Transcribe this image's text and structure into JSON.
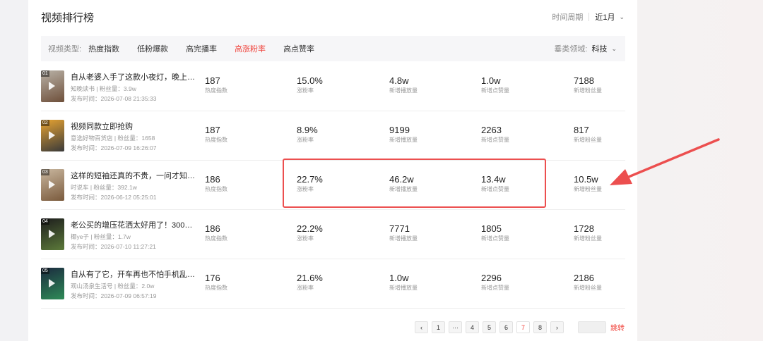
{
  "header": {
    "title": "视频排行榜",
    "period_label": "时间周期",
    "period_value": "近1月"
  },
  "filters": {
    "type_label": "视频类型:",
    "items": [
      "热度指数",
      "低粉爆款",
      "高完播率",
      "高涨粉率",
      "高点赞率"
    ],
    "active_index": 3,
    "domain_label": "垂类领域:",
    "domain_value": "科技"
  },
  "rows": [
    {
      "rank": "01",
      "title": "自从老婆入手了这款小夜灯，晚上再…",
      "meta": "知晚读书 | 粉丝量：3.9w",
      "time": "发布时间：2026-07-08 21:35:33",
      "metrics": [
        {
          "v": "187",
          "l": "热度指数"
        },
        {
          "v": "15.0%",
          "l": "涨粉率"
        },
        {
          "v": "4.8w",
          "l": "新增播放量"
        },
        {
          "v": "1.0w",
          "l": "新增点赞量"
        },
        {
          "v": "7188",
          "l": "新增粉丝量"
        }
      ],
      "thumb_colors": [
        "#b9b2a7",
        "#6e4f3a"
      ]
    },
    {
      "rank": "02",
      "title": "视频同款立即抢购",
      "meta": "意选好物百货店 | 粉丝量：1658",
      "time": "发布时间：2026-07-09 16:26:07",
      "metrics": [
        {
          "v": "187",
          "l": "热度指数"
        },
        {
          "v": "8.9%",
          "l": "涨粉率"
        },
        {
          "v": "9199",
          "l": "新增播放量"
        },
        {
          "v": "2263",
          "l": "新增点赞量"
        },
        {
          "v": "817",
          "l": "新增粉丝量"
        }
      ],
      "thumb_colors": [
        "#e7a331",
        "#3a3a3a"
      ]
    },
    {
      "rank": "03",
      "title": "这样的短袖还真的不贵，一问才知道…",
      "meta": "时说车 | 粉丝量：392.1w",
      "time": "发布时间：2026-06-12 05:25:01",
      "metrics": [
        {
          "v": "186",
          "l": "热度指数"
        },
        {
          "v": "22.7%",
          "l": "涨粉率"
        },
        {
          "v": "46.2w",
          "l": "新增播放量"
        },
        {
          "v": "13.4w",
          "l": "新增点赞量"
        },
        {
          "v": "10.5w",
          "l": "新增粉丝量"
        }
      ],
      "thumb_colors": [
        "#c9b79f",
        "#7a5a3c"
      ]
    },
    {
      "rank": "04",
      "title": "老公买的增压花洒太好用了！300孔…",
      "meta": "椰ye子 | 粉丝量：1.7w",
      "time": "发布时间：2026-07-10 11:27:21",
      "metrics": [
        {
          "v": "186",
          "l": "热度指数"
        },
        {
          "v": "22.2%",
          "l": "涨粉率"
        },
        {
          "v": "7771",
          "l": "新增播放量"
        },
        {
          "v": "1805",
          "l": "新增点赞量"
        },
        {
          "v": "1728",
          "l": "新增粉丝量"
        }
      ],
      "thumb_colors": [
        "#1d1d1d",
        "#5c7a3a"
      ]
    },
    {
      "rank": "05",
      "title": "自从有了它，开车再也不怕手机乱糟…",
      "meta": "观山汤泉生活号 | 粉丝量：2.0w",
      "time": "发布时间：2026-07-09 06:57:19",
      "metrics": [
        {
          "v": "176",
          "l": "热度指数"
        },
        {
          "v": "21.6%",
          "l": "涨粉率"
        },
        {
          "v": "1.0w",
          "l": "新增播放量"
        },
        {
          "v": "2296",
          "l": "新增点赞量"
        },
        {
          "v": "2186",
          "l": "新增粉丝量"
        }
      ],
      "thumb_colors": [
        "#1b2a3f",
        "#2e8b57"
      ]
    }
  ],
  "pagination": {
    "prev": "‹",
    "pages": [
      "1",
      "···",
      "4",
      "5",
      "6",
      "7",
      "8"
    ],
    "active": "7",
    "next": "›",
    "jump_label": "跳转"
  },
  "accent_color": "#f0443c",
  "annotation_color": "#ec4f4f"
}
